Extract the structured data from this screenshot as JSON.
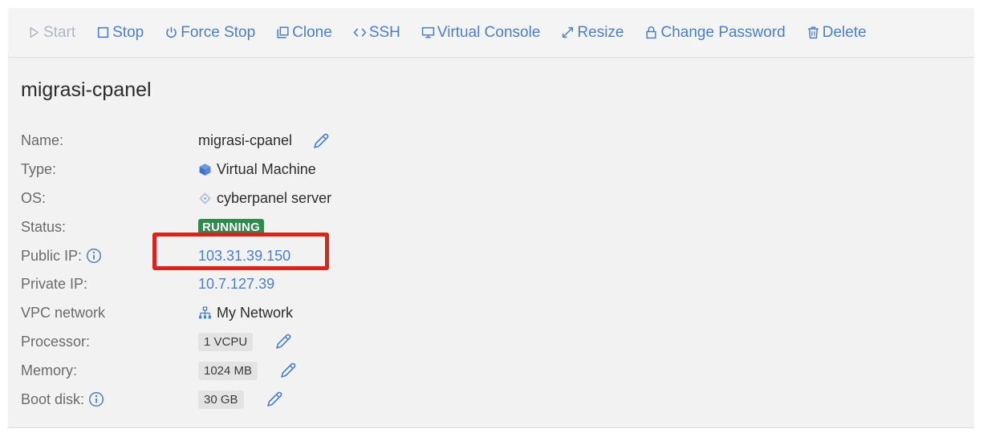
{
  "toolbar": {
    "start": "Start",
    "stop": "Stop",
    "force_stop": "Force Stop",
    "clone": "Clone",
    "ssh": "SSH",
    "virtual_console": "Virtual Console",
    "resize": "Resize",
    "change_password": "Change Password",
    "delete": "Delete"
  },
  "server": {
    "title": "migrasi-cpanel",
    "fields": {
      "name_label": "Name:",
      "name_value": "migrasi-cpanel",
      "type_label": "Type:",
      "type_value": "Virtual Machine",
      "os_label": "OS:",
      "os_value": "cyberpanel server",
      "status_label": "Status:",
      "status_value": "RUNNING",
      "public_ip_label": "Public IP:",
      "public_ip_value": "103.31.39.150",
      "private_ip_label": "Private IP:",
      "private_ip_value": "10.7.127.39",
      "vpc_label": "VPC network",
      "vpc_value": "My Network",
      "processor_label": "Processor:",
      "processor_value": "1 VCPU",
      "memory_label": "Memory:",
      "memory_value": "1024 MB",
      "boot_disk_label": "Boot disk:",
      "boot_disk_value": "30 GB"
    }
  },
  "colors": {
    "accent": "#4a7fd0",
    "status_running": "#2e8b4c",
    "highlight": "#d9231d"
  },
  "icons": {
    "start": "play-outline-icon",
    "stop": "square-icon",
    "force_stop": "power-icon",
    "clone": "copy-icon",
    "ssh": "code-brackets-icon",
    "virtual_console": "monitor-icon",
    "resize": "expand-arrows-icon",
    "change_password": "lock-icon",
    "delete": "trash-icon",
    "type": "cube-icon",
    "os": "diamond-icon",
    "vpc": "network-icon",
    "edit": "pencil-icon",
    "info": "info-circle-icon"
  }
}
